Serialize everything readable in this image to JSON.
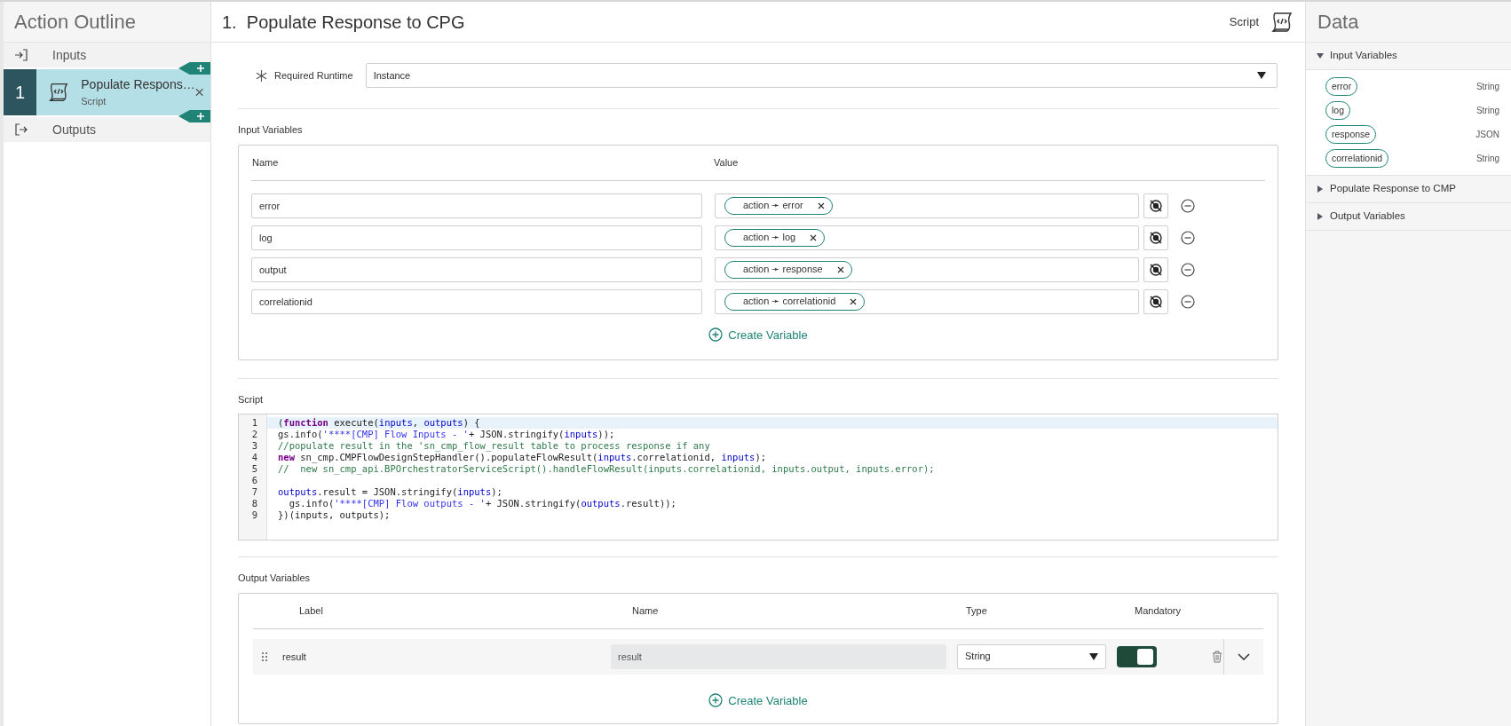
{
  "sidebar": {
    "title": "Action Outline",
    "inputs_label": "Inputs",
    "steps": [
      {
        "number": "1",
        "title": "Populate Respons…",
        "subtitle": "Script",
        "selected": true
      }
    ],
    "outputs_label": "Outputs"
  },
  "step_header": {
    "title": "1.  Populate Response to CPG",
    "type_label": "Script"
  },
  "required_runtime": {
    "label": "Required Runtime",
    "value": "Instance"
  },
  "input_variables": {
    "title": "Input Variables",
    "columns": [
      "Name",
      "Value"
    ],
    "rows": [
      {
        "name": "error",
        "pill": "action ➛ error"
      },
      {
        "name": "log",
        "pill": "action ➛ log"
      },
      {
        "name": "output",
        "pill": "action ➛ response"
      },
      {
        "name": "correlationid",
        "pill": "action ➛ correlationid"
      }
    ],
    "create_label": "Create Variable"
  },
  "script": {
    "title": "Script",
    "lines": [
      {
        "number": "1",
        "highlighted": true,
        "tokens": [
          {
            "kind": "plain",
            "text": "("
          },
          {
            "kind": "keyword",
            "text": "function"
          },
          {
            "kind": "plain",
            "text": " execute("
          },
          {
            "kind": "var",
            "text": "inputs"
          },
          {
            "kind": "plain",
            "text": ", "
          },
          {
            "kind": "var",
            "text": "outputs"
          },
          {
            "kind": "plain",
            "text": ") {"
          }
        ]
      },
      {
        "number": "2",
        "highlighted": false,
        "tokens": [
          {
            "kind": "plain",
            "text": "gs.info("
          },
          {
            "kind": "string",
            "text": "'****[CMP] Flow Inputs - '"
          },
          {
            "kind": "plain",
            "text": "+ JSON.stringify("
          },
          {
            "kind": "var",
            "text": "inputs"
          },
          {
            "kind": "plain",
            "text": "));"
          }
        ]
      },
      {
        "number": "3",
        "highlighted": false,
        "tokens": [
          {
            "kind": "comment",
            "text": "//populate result in the 'sn_cmp_flow_result table to process response if any"
          }
        ]
      },
      {
        "number": "4",
        "highlighted": false,
        "tokens": [
          {
            "kind": "keyword",
            "text": "new"
          },
          {
            "kind": "plain",
            "text": " sn_cmp.CMPFlowDesignStepHandler().populateFlowResult("
          },
          {
            "kind": "var",
            "text": "inputs"
          },
          {
            "kind": "plain",
            "text": ".correlationid, "
          },
          {
            "kind": "var",
            "text": "inputs"
          },
          {
            "kind": "plain",
            "text": ");"
          }
        ]
      },
      {
        "number": "5",
        "highlighted": false,
        "tokens": [
          {
            "kind": "comment",
            "text": "//  new sn_cmp_api.BPOrchestratorServiceScript().handleFlowResult(inputs.correlationid, inputs.output, inputs.error);"
          }
        ]
      },
      {
        "number": "6",
        "highlighted": false
      },
      {
        "number": "7",
        "highlighted": false,
        "tokens": [
          {
            "kind": "var",
            "text": "outputs"
          },
          {
            "kind": "plain",
            "text": ".result = JSON.stringify("
          },
          {
            "kind": "var",
            "text": "inputs"
          },
          {
            "kind": "plain",
            "text": ");"
          }
        ]
      },
      {
        "number": "8",
        "highlighted": false,
        "tokens": [
          {
            "kind": "plain",
            "text": "  gs.info("
          },
          {
            "kind": "string",
            "text": "'****[CMP] Flow outputs - '"
          },
          {
            "kind": "plain",
            "text": "+ JSON.stringify("
          },
          {
            "kind": "var",
            "text": "outputs"
          },
          {
            "kind": "plain",
            "text": ".result));"
          }
        ]
      },
      {
        "number": "9",
        "highlighted": false,
        "tokens": [
          {
            "kind": "plain",
            "text": "})(inputs, outputs);"
          }
        ]
      }
    ]
  },
  "output_variables": {
    "title": "Output Variables",
    "columns": [
      "Label",
      "Name",
      "Type",
      "Mandatory"
    ],
    "rows": [
      {
        "label": "result",
        "name": "result",
        "type": "String",
        "mandatory": true
      }
    ],
    "create_label": "Create Variable"
  },
  "data_panel": {
    "title": "Data",
    "sections": [
      {
        "title": "Input Variables",
        "expanded": true,
        "items": [
          {
            "pill": "error",
            "type": "String"
          },
          {
            "pill": "log",
            "type": "String"
          },
          {
            "pill": "response",
            "type": "JSON"
          },
          {
            "pill": "correlationid",
            "type": "String"
          }
        ]
      },
      {
        "title": "Populate Response to CMP",
        "expanded": false
      },
      {
        "title": "Output Variables",
        "expanded": false
      }
    ]
  }
}
